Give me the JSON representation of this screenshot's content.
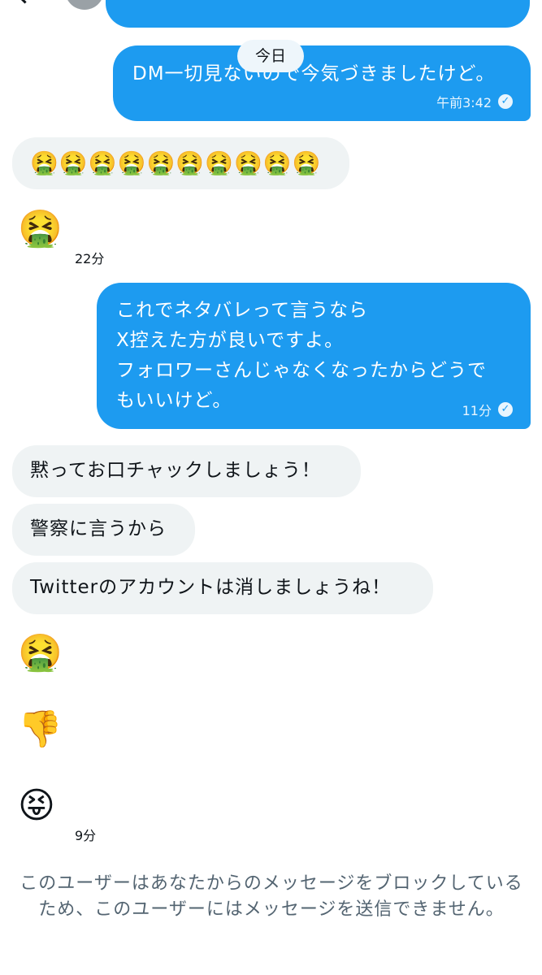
{
  "header": {
    "back_icon": "chevron-left-icon",
    "name": "",
    "call_icon": "phone-icon",
    "info_icon": "info-icon"
  },
  "date_divider": "今日",
  "messages": {
    "m1": {
      "text": "DM一切見ないので今気づきましたけど。",
      "time": "午前3:42",
      "read": true
    },
    "m2": {
      "text": "🤮🤮🤮🤮🤮🤮🤮🤮🤮🤮"
    },
    "m3": {
      "text": "🤮",
      "time": "22分"
    },
    "m4": {
      "text": "これでネタバレって言うなら\nX控えた方が良いですよ。\nフォロワーさんじゃなくなったからどうで\nもいいけど。",
      "time": "11分",
      "read": true
    },
    "m5": {
      "text": "黙ってお口チャックしましょう！"
    },
    "m6": {
      "text": "警察に言うから"
    },
    "m7": {
      "text": "Twitterのアカウントは消しましょうね！"
    },
    "m8": {
      "text": "🤮"
    },
    "m9": {
      "text": "👎"
    },
    "m10": {
      "text": "😝",
      "time": "9分"
    }
  },
  "block_notice": "このユーザーはあなたからのメッセージをブロックしているため、このユーザーにはメッセージを送信できません。",
  "colors": {
    "sent_bubble": "#1d9bf0",
    "received_bubble": "#eff3f4",
    "notice_text": "#536471"
  }
}
